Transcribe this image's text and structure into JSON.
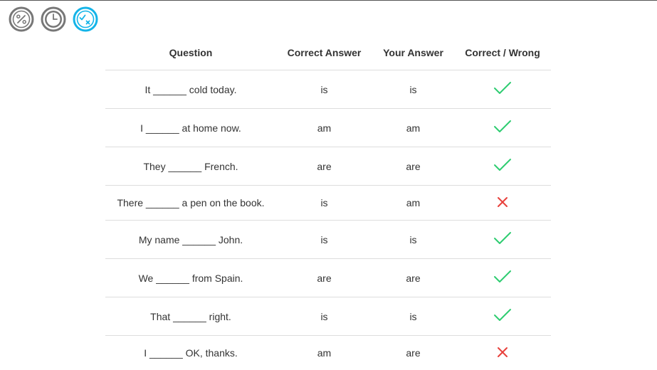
{
  "toolbar": {
    "percent_icon": "percent-icon",
    "clock_icon": "clock-icon",
    "check_icon": "check-x-icon",
    "active_color": "#14b4e8",
    "inactive_color": "#777777"
  },
  "table": {
    "headers": {
      "question": "Question",
      "correct_answer": "Correct Answer",
      "your_answer": "Your Answer",
      "result": "Correct / Wrong"
    },
    "rows": [
      {
        "question": "It ______ cold today.",
        "correct": "is",
        "yours": "is",
        "result": "correct"
      },
      {
        "question": "I ______ at home now.",
        "correct": "am",
        "yours": "am",
        "result": "correct"
      },
      {
        "question": "They ______ French.",
        "correct": "are",
        "yours": "are",
        "result": "correct"
      },
      {
        "question": "There ______ a pen on the book.",
        "correct": "is",
        "yours": "am",
        "result": "wrong"
      },
      {
        "question": "My name ______ John.",
        "correct": "is",
        "yours": "is",
        "result": "correct"
      },
      {
        "question": "We ______ from Spain.",
        "correct": "are",
        "yours": "are",
        "result": "correct"
      },
      {
        "question": "That ______ right.",
        "correct": "is",
        "yours": "is",
        "result": "correct"
      },
      {
        "question": "I ______ OK, thanks.",
        "correct": "am",
        "yours": "are",
        "result": "wrong"
      }
    ]
  },
  "colors": {
    "correct": "#2ecc71",
    "wrong": "#e8413c"
  }
}
